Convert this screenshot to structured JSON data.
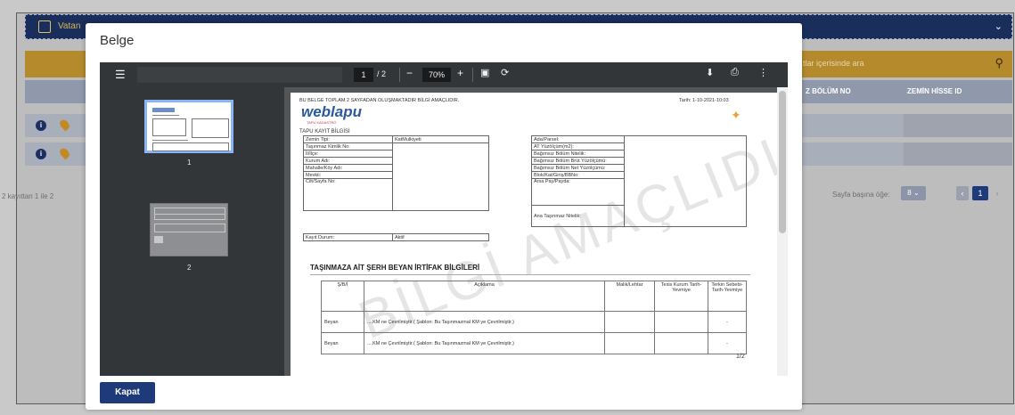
{
  "background": {
    "header_title": "Vatan",
    "search_placeholder": "tlar içerisinde ara",
    "col_headers": [
      "Z BÖLÜM NO",
      "ZEMİN HİSSE ID"
    ],
    "record_count": "2 kayıttan 1 ile 2",
    "page_size_label": "Sayfa başına öğe:",
    "page_size_value": "8",
    "current_page": "1"
  },
  "modal": {
    "title": "Belge",
    "close_button": "Kapat"
  },
  "viewer": {
    "page_current": "1",
    "page_total": "/ 2",
    "zoom": "70%",
    "thumbnail_labels": [
      "1",
      "2"
    ]
  },
  "document": {
    "header_note": "BU BELGE TOPLAM 2 SAYFADAN OLUŞMAKTADIR BİLGİ AMAÇLIDIR.",
    "date": "Tarih: 1-10-2021-10:03",
    "logo_text": "weblapu",
    "logo_sub": "TAPU KADASTRO",
    "section_title": "TAPU KAYIT BİLGİSİ",
    "left_fields": [
      {
        "label": "Zemin Tipi:",
        "value": "KatMulkiyeti"
      },
      {
        "label": "Taşınmaz Kimlik No:",
        "value": ""
      },
      {
        "label": "İl/İlçe:",
        "value": ""
      },
      {
        "label": "Kurum Adı:",
        "value": ""
      },
      {
        "label": "Mahalle/Köy Adı:",
        "value": ""
      },
      {
        "label": "Mevkii:",
        "value": ""
      },
      {
        "label": "Cilt/Sayfa No:",
        "value": ""
      }
    ],
    "kayit_durum": {
      "label": "Kayıt Durum:",
      "value": "Aktif"
    },
    "right_fields": [
      "Ada/Parsel:",
      "AT Yüzölçüm(m2):",
      "Bağımsız Bölüm Nitelik:",
      "Bağımsız Bölüm Brüt Yüzölçümü:",
      "Bağımsız Bölüm Net Yüzölçümü:",
      "Blok/Kat/Giriş/BBNo:",
      "Arsa Pay/Payda:",
      "Ana Taşınmaz Nitelik:"
    ],
    "ikb_title": "TAŞINMAZA AİT ŞERH BEYAN İRTİFAK BİLGİLERİ",
    "ikb_headers": [
      "Ş/B/İ",
      "Açıklama",
      "Malik/Lehtar",
      "Tesis Kurum Tarih-Yevmiye",
      "Terkin Sebebi-Tarih-Yevmiye"
    ],
    "ikb_rows": [
      {
        "type": "Beyan",
        "desc": "....KM ne Çevrilmiştir.( Şablon: Bu Taşınmazmal KM ye Çevrilmiştir.)",
        "terkin": "-"
      },
      {
        "type": "Beyan",
        "desc": "....KM ne Çevrilmiştir.( Şablon: Bu Taşınmazmal KM ye Çevrilmiştir.)",
        "terkin": "-"
      }
    ],
    "page_number": "1/2",
    "watermark": "BİLGİ AMAÇLIDIR"
  }
}
